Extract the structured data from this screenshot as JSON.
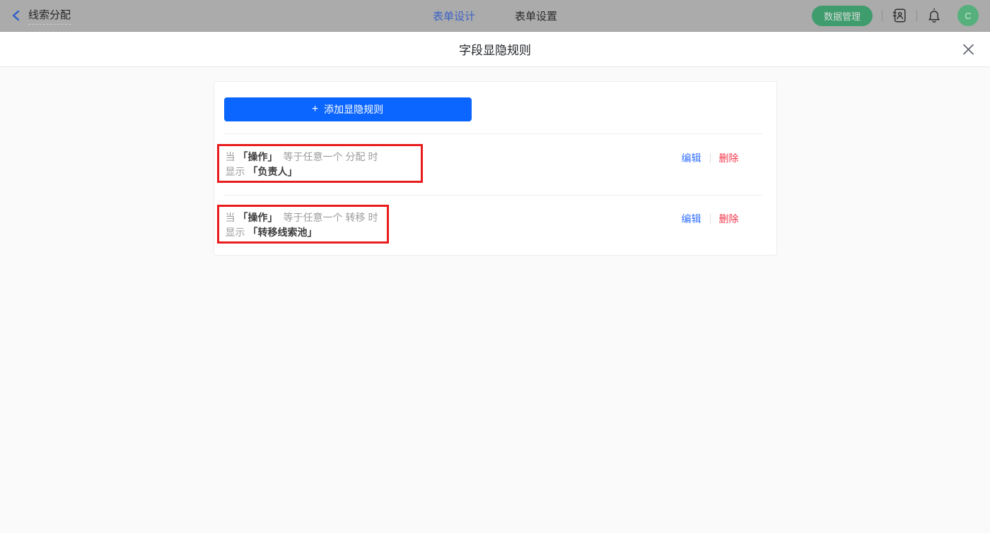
{
  "header": {
    "back": {
      "label": "线索分配"
    },
    "tabs": [
      {
        "label": "表单设计",
        "active": true
      },
      {
        "label": "表单设置",
        "active": false
      }
    ],
    "actions": {
      "data_manage_label": "数据管理",
      "avatar_text": "C"
    }
  },
  "modal": {
    "title": "字段显隐规则"
  },
  "panel": {
    "add_button": {
      "plus": "+",
      "label": "添加显隐规则"
    },
    "rules": [
      {
        "when": "当",
        "field": "「操作」",
        "condition": "等于任意一个",
        "value": "分配",
        "suffix": "时",
        "show": "显示",
        "target": "「负责人」",
        "edit": "编辑",
        "remove": "删除"
      },
      {
        "when": "当",
        "field": "「操作」",
        "condition": "等于任意一个",
        "value": "转移",
        "suffix": "时",
        "show": "显示",
        "target": "「转移线索池」",
        "edit": "编辑",
        "remove": "删除"
      }
    ]
  },
  "icons": {
    "back": "chevron-left",
    "contacts": "contacts-book",
    "notification": "bell-with-dot",
    "close": "x-cross",
    "plus": "plus-sign"
  },
  "colors": {
    "primary_blue": "#0b65ff",
    "edit_link_blue": "#3370ff",
    "delete_link_red": "#f2384a",
    "annotation_red": "#e91c1c",
    "header_dimmed_gray": "#ababab",
    "active_tab_blue": "#3b62c4",
    "green_button": "#3f9c6d",
    "avatar_green": "#55b07c",
    "page_background": "#fafafa"
  }
}
